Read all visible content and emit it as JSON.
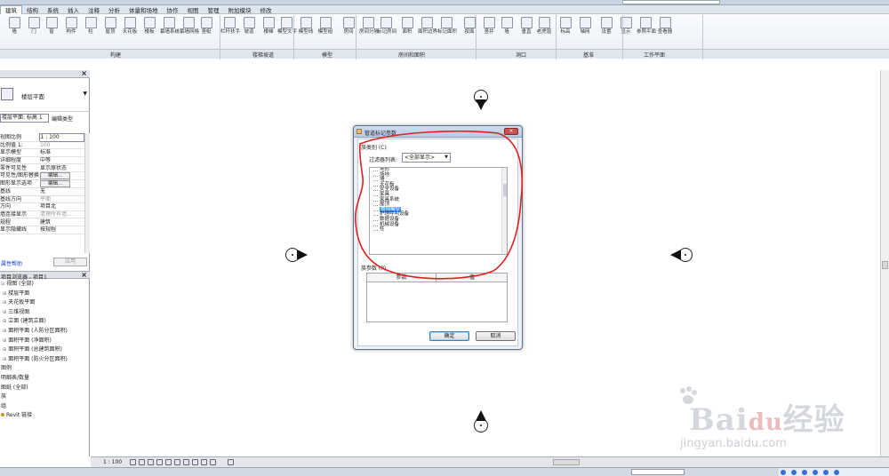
{
  "menu": {
    "items": [
      "建筑",
      "结构",
      "系统",
      "插入",
      "注释",
      "分析",
      "体量和场地",
      "协作",
      "视图",
      "管理",
      "附加模块",
      "修改"
    ],
    "active_index": 0
  },
  "ribbon": {
    "buttons": [
      "墙",
      "门",
      "窗",
      "构件",
      "柱",
      "屋顶",
      "天花板",
      "楼板",
      "幕墙系统",
      "幕墙网格",
      "竖梃",
      "栏杆扶手",
      "坡道",
      "楼梯",
      "模型文字",
      "模型线",
      "模型组",
      "房间",
      "房间分隔",
      "标记房间",
      "面积",
      "面积边界",
      "标记面积",
      "按面",
      "竖井",
      "墙",
      "垂直",
      "老虎窗",
      "标高",
      "轴网",
      "设置",
      "显示",
      "参照平面",
      "查看器"
    ],
    "panels": [
      "构建",
      "楼梯坡道",
      "模型",
      "房间和面积",
      "洞口",
      "基准",
      "工作平面"
    ]
  },
  "properties": {
    "title": "属性",
    "type_name": "楼层平面",
    "instance_selector": "楼层平面: 标高 1",
    "edit_type_label": "编辑类型",
    "rows": [
      {
        "k": "视图比例",
        "v": "1 : 100",
        "field": true
      },
      {
        "k": "比例值 1:",
        "v": "100",
        "grey": true
      },
      {
        "k": "显示模型",
        "v": "标准"
      },
      {
        "k": "详细程度",
        "v": "中等"
      },
      {
        "k": "零件可见性",
        "v": "显示原状态"
      },
      {
        "k": "可见性/图形替换",
        "btn": "编辑..."
      },
      {
        "k": "图形显示选项",
        "btn": "编辑..."
      },
      {
        "k": "基线",
        "v": "无"
      },
      {
        "k": "基线方向",
        "v": "平面",
        "grey": true
      },
      {
        "k": "方向",
        "v": "项目北"
      },
      {
        "k": "墙连接显示",
        "v": "清理所有墙...",
        "grey": true
      },
      {
        "k": "规程",
        "v": "建筑"
      },
      {
        "k": "显示隐藏线",
        "v": "按规程"
      }
    ],
    "help_link": "属性帮助",
    "apply_label": "应用"
  },
  "browser": {
    "title": "项目浏览器 - 项目1",
    "items": [
      {
        "label": "视图 (全部)",
        "level": 0,
        "toggle": "⊟"
      },
      {
        "label": "楼层平面",
        "level": 1,
        "toggle": "⊞"
      },
      {
        "label": "天花板平面",
        "level": 1,
        "toggle": "⊞"
      },
      {
        "label": "三维视图",
        "level": 1,
        "toggle": "⊞"
      },
      {
        "label": "立面 (建筑立面)",
        "level": 1,
        "toggle": "⊞"
      },
      {
        "label": "面积平面 (人防分区面积)",
        "level": 1,
        "toggle": "⊞"
      },
      {
        "label": "面积平面 (净面积)",
        "level": 1,
        "toggle": "⊞"
      },
      {
        "label": "面积平面 (总建筑面积)",
        "level": 1,
        "toggle": "⊞"
      },
      {
        "label": "面积平面 (防火分区面积)",
        "level": 1,
        "toggle": "⊞"
      },
      {
        "label": "图例",
        "level": 0,
        "toggle": ""
      },
      {
        "label": "明细表/数量",
        "level": 0,
        "toggle": ""
      },
      {
        "label": "图纸 (全部)",
        "level": 0,
        "toggle": ""
      },
      {
        "label": "族",
        "level": 0,
        "toggle": ""
      },
      {
        "label": "组",
        "level": 0,
        "toggle": ""
      },
      {
        "label": "Revit 链接",
        "level": 0,
        "toggle": "",
        "revit": true
      }
    ]
  },
  "statusbar": {
    "scale": "1 : 100"
  },
  "dialog": {
    "title": "管道标记参数",
    "subcategory_label": "族类别 (C)",
    "filter_label": "过滤器列表:",
    "filter_value": "<全部显示>",
    "categories": [
      "地形",
      "场地",
      "墙",
      "天花板",
      "安全设备",
      "家具",
      "家具系统",
      "屋顶",
      "常规模型",
      "护理呼叫设备",
      "数据设备",
      "机械设备",
      "柱"
    ],
    "selected_index": 8,
    "params_label": "族参数 (P)",
    "col_param": "参数",
    "col_value": "值",
    "ok_label": "确定",
    "cancel_label": "取消"
  },
  "watermark": {
    "brand": "Bai",
    "brand_cn": "经验",
    "url": "jingyan.baidu.com"
  },
  "colors": {
    "annotation": "#e02020",
    "accent": "#3399ff",
    "ribbon_bg": "#e9eef4"
  }
}
